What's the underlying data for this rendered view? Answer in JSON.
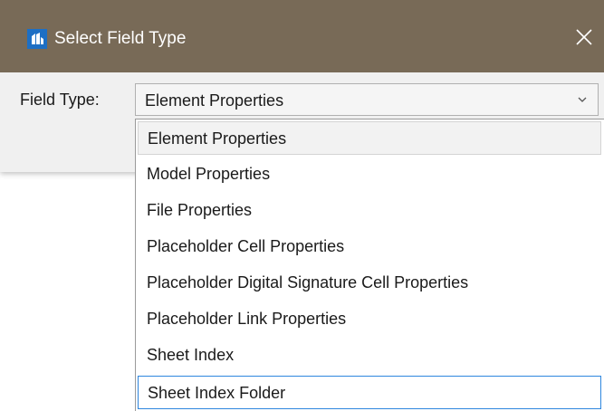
{
  "dialog": {
    "title": "Select Field Type",
    "title_bar_color": "#786a57",
    "icon": "app-logo-icon",
    "close_icon": "close-icon"
  },
  "form": {
    "field_label": "Field Type:",
    "selected_value": "Element Properties"
  },
  "dropdown": {
    "options": [
      {
        "label": "Element Properties",
        "state": "selected"
      },
      {
        "label": "Model Properties",
        "state": "normal"
      },
      {
        "label": "File Properties",
        "state": "normal"
      },
      {
        "label": "Placeholder Cell Properties",
        "state": "normal"
      },
      {
        "label": "Placeholder Digital Signature Cell Properties",
        "state": "normal"
      },
      {
        "label": "Placeholder Link Properties",
        "state": "normal"
      },
      {
        "label": "Sheet Index",
        "state": "normal"
      },
      {
        "label": "Sheet Index Folder",
        "state": "focused"
      }
    ],
    "focus_color": "#2e86de"
  }
}
